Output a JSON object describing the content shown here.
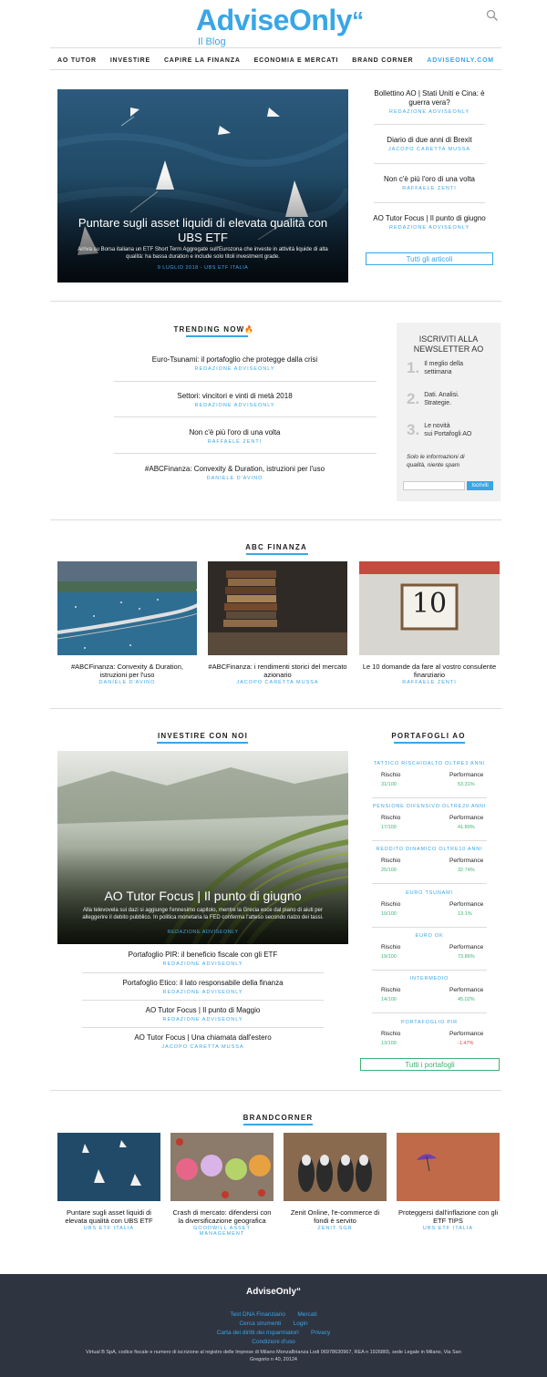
{
  "header": {
    "logo_main": "AdviseOnly",
    "logo_mark": "“",
    "logo_sub": "Il Blog",
    "search_icon": "search-icon"
  },
  "nav": {
    "items": [
      "AO TUTOR",
      "INVESTIRE",
      "CAPIRE LA FINANZA",
      "ECONOMIA E MERCATI",
      "BRAND CORNER",
      "ADVISEONLY.COM"
    ]
  },
  "hero": {
    "title": "Puntare sugli asset liquidi di elevata qualità con UBS ETF",
    "text": "Arriva su Borsa italiana un ETF Short Term Aggregate sull'Eurozona che investe in attività liquide di alta qualità: ha bassa duration e include solo titoli investment grade.",
    "meta": "9 LUGLIO 2018 - UBS ETF ITALIA"
  },
  "side_articles": [
    {
      "title": "Bollettino AO | Stati Uniti e Cina: è guerra vera?",
      "author": "REDAZIONE ADVISEONLY"
    },
    {
      "title": "Diario di due anni di Brexit",
      "author": "JACOPO CARETTA MUSSA"
    },
    {
      "title": "Non c'è più l'oro di una volta",
      "author": "RAFFAELE ZENTI"
    },
    {
      "title": "AO Tutor Focus | Il punto di giugno",
      "author": "REDAZIONE ADVISEONLY"
    }
  ],
  "all_articles_label": "Tutti gli articoli",
  "trending": {
    "title": "TRENDING NOW",
    "items": [
      {
        "title": "Euro-Tsunami: il portafoglio che protegge dalla crisi",
        "author": "REDAZIONE ADVISEONLY"
      },
      {
        "title": "Settori: vincitori e vinti di metà 2018",
        "author": "REDAZIONE ADVISEONLY"
      },
      {
        "title": "Non c'è più l'oro di una volta",
        "author": "RAFFAELE ZENTI"
      },
      {
        "title": "#ABCFinanza: Convexity & Duration, istruzioni per l'uso",
        "author": "DANIELE D'AVINO"
      }
    ]
  },
  "newsletter": {
    "title_line1": "ISCRIVITI ALLA",
    "title_line2": "NEWSLETTER AO",
    "points": [
      {
        "num": "1.",
        "line1": "Il meglio della",
        "line2": "settimana"
      },
      {
        "num": "2.",
        "line1": "Dati. Analisi.",
        "line2": "Strategie."
      },
      {
        "num": "3.",
        "line1": "Le novità",
        "line2": "sui Portafogli AO"
      }
    ],
    "note_line1": "Solo le informazioni di",
    "note_line2": "qualità, niente spam",
    "input_placeholder": "",
    "button": "Iscriviti"
  },
  "abc": {
    "title": "ABC FINANZA",
    "cards": [
      {
        "title": "#ABCFinanza: Convexity & Duration, istruzioni per l'uso",
        "author": "DANIELE D'AVINO"
      },
      {
        "title": "#ABCFinanza: i rendimenti storici del mercato azionario",
        "author": "JACOPO CARETTA MUSSA"
      },
      {
        "title": "Le 10 domande da fare al vostro consulente finanziario",
        "author": "RAFFAELE ZENTI"
      }
    ],
    "tile_number": "10"
  },
  "investire": {
    "title": "INVESTIRE CON NOI",
    "hero_title": "AO Tutor Focus | Il punto di giugno",
    "hero_text": "Alla televovela sui dazi si aggiunge l'ennesimo capitolo, mentre la Grecia esce dal piano di aiuti per alleggerire il debito pubblico. In politica monetaria la FED conferma l'atteso secondo rialzo dei tassi.",
    "hero_author": "REDAZIONE ADVISEONLY",
    "items": [
      {
        "title": "Portafoglio PIR: il beneficio fiscale con gli ETF",
        "author": "REDAZIONE ADVISEONLY"
      },
      {
        "title": "Portafoglio Etico: il lato responsabile della finanza",
        "author": "REDAZIONE ADVISEONLY"
      },
      {
        "title": "AO Tutor Focus | Il punto di Maggio",
        "author": "REDAZIONE ADVISEONLY"
      },
      {
        "title": "AO Tutor Focus | Una chiamata dall'estero",
        "author": "JACOPO CARETTA MUSSA"
      }
    ]
  },
  "portafogli": {
    "title": "PORTAFOGLI AO",
    "risk_label": "Rischio",
    "perf_label": "Performance",
    "items": [
      {
        "name": "TATTICO RISCHIOALTO OLTRE3 ANNI",
        "risk": "31/100",
        "perf": "53.31%",
        "neg": false
      },
      {
        "name": "PENSIONE DIFENSIVO OLTRE20 ANNI",
        "risk": "17/100",
        "perf": "41.89%",
        "neg": false
      },
      {
        "name": "REDDITO DINAMICO OLTRE10 ANNI",
        "risk": "25/100",
        "perf": "32.74%",
        "neg": false
      },
      {
        "name": "EURO TSUNAMI",
        "risk": "10/100",
        "perf": "13.1%",
        "neg": false
      },
      {
        "name": "EURO OK",
        "risk": "19/100",
        "perf": "73.86%",
        "neg": false
      },
      {
        "name": "INTERMEDIO",
        "risk": "14/100",
        "perf": "45.02%",
        "neg": false
      },
      {
        "name": "PORTAFOGLIO PIR",
        "risk": "13/100",
        "perf": "-1.47%",
        "neg": true
      }
    ],
    "all_label": "Tutti i portafogli"
  },
  "brandcorner": {
    "title": "BRANDCORNER",
    "cards": [
      {
        "title": "Puntare sugli asset liquidi di elevata qualità con UBS ETF",
        "author": "UBS ETF ITALIA"
      },
      {
        "title": "Crash di mercato: difendersi con la diversificazione geografica",
        "author": "GOODWILL ASSET MANAGEMENT"
      },
      {
        "title": "Zenit Online, l'e-commerce di fondi è servito",
        "author": "ZENIT SGR"
      },
      {
        "title": "Proteggersi dall'inflazione con gli ETF TIPS",
        "author": "UBS ETF ITALIA"
      }
    ]
  },
  "footer": {
    "logo": "AdviseOnly",
    "logo_mark": "“",
    "links_row1": [
      "Test DNA Finanziario",
      "Mercati"
    ],
    "links_row2": [
      "Cerca strumenti",
      "Login"
    ],
    "links_row3": [
      "Carta dei diritti dei risparmiatori",
      "Privacy"
    ],
    "links_row4": [
      "Condizioni d'uso"
    ],
    "legal_line1": "Virtual B SpA, codice fiscale e numero di iscrizione al registro delle Imprese di Milano MonzaBrianza Lodi 06978630967, REA n 1926865, sede Legale in Milano, Via San",
    "legal_line2": "Gregorio n 40, 20124"
  },
  "colors": {
    "accent": "#38a6e6",
    "positive": "#3cb371",
    "negative": "#e04545",
    "footer_bg": "#2f3441"
  }
}
